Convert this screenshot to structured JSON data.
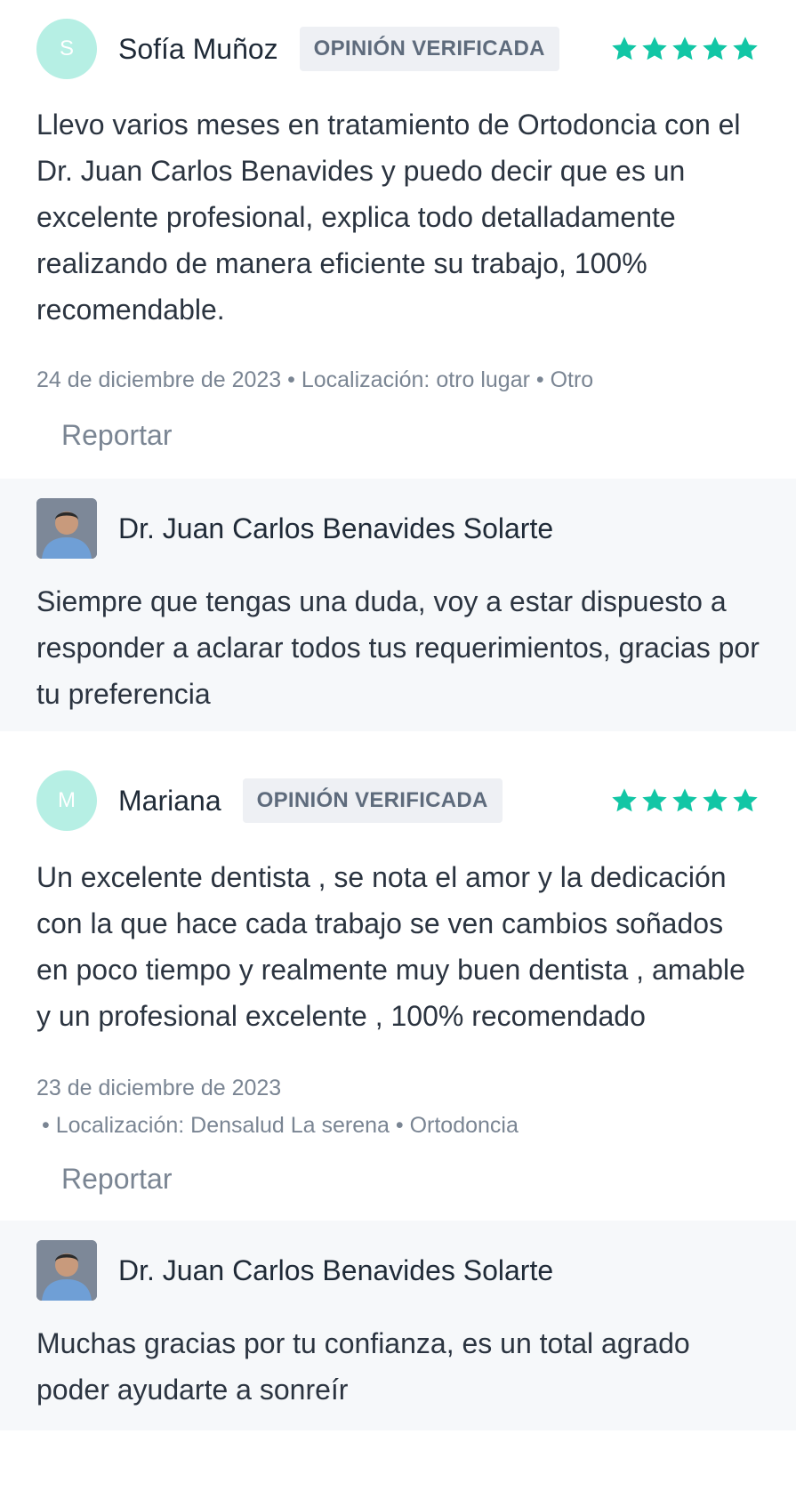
{
  "reviews": [
    {
      "initial": "S",
      "author": "Sofía Muñoz",
      "badge": "OPINIÓN VERIFICADA",
      "rating": 5,
      "text": "Llevo varios meses en tratamiento de Ortodoncia con el Dr. Juan Carlos Benavides y puedo decir que es un excelente profesional, explica todo detalladamente realizando de manera eficiente su trabajo, 100% recomendable.",
      "meta_line1": "24 de diciembre de 2023 • Localización: otro lugar • Otro",
      "meta_line2": "",
      "report_label": "Reportar",
      "reply": {
        "author": "Dr. Juan Carlos Benavides Solarte",
        "text": "Siempre que tengas una duda, voy a estar dispuesto a responder a aclarar todos tus requerimientos, gracias por tu preferencia"
      }
    },
    {
      "initial": "M",
      "author": "Mariana",
      "badge": "OPINIÓN VERIFICADA",
      "rating": 5,
      "text": "Un excelente dentista , se nota el amor y la dedicación con la que hace cada trabajo se ven cambios soñados en poco tiempo y realmente muy buen dentista , amable y un profesional excelente , 100% recomendado",
      "meta_line1": "23 de diciembre de 2023",
      "meta_line2": "• Localización: Densalud La serena • Ortodoncia",
      "report_label": "Reportar",
      "reply": {
        "author": "Dr. Juan Carlos Benavides Solarte",
        "text": "Muchas gracias por tu confianza, es un total agrado poder ayudarte a sonreír"
      }
    }
  ],
  "colors": {
    "star": "#12c6a5",
    "avatar_bg": "#b6efe4",
    "reply_bg": "#f6f8fa",
    "badge_bg": "#eef0f4"
  }
}
